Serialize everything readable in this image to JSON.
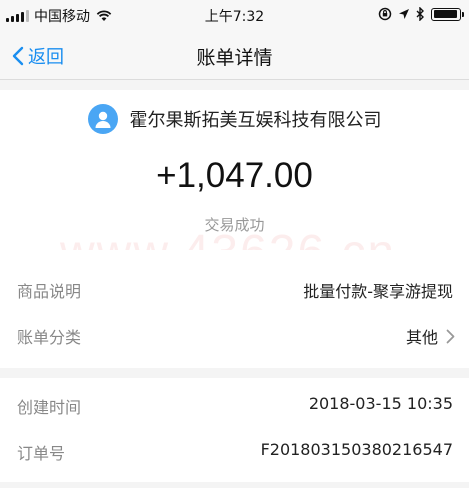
{
  "status_bar": {
    "carrier": "中国移动",
    "time": "上午7:32"
  },
  "nav": {
    "back_label": "返回",
    "title": "账单详情"
  },
  "header": {
    "merchant": "霍尔果斯拓美互娱科技有限公司",
    "amount": "+1,047.00",
    "status": "交易成功",
    "avatar_color": "#4aa6f4"
  },
  "details": {
    "group1": [
      {
        "label": "商品说明",
        "value": "批量付款-聚享游提现"
      },
      {
        "label": "账单分类",
        "value": "其他"
      }
    ],
    "group2": [
      {
        "label": "创建时间",
        "value": "2018-03-15 10:35"
      },
      {
        "label": "订单号",
        "value": "F20180315038021654​7"
      }
    ]
  },
  "watermark": "www.43626.cn",
  "colors": {
    "accent": "#1a8ef0",
    "label_gray": "#888888"
  }
}
